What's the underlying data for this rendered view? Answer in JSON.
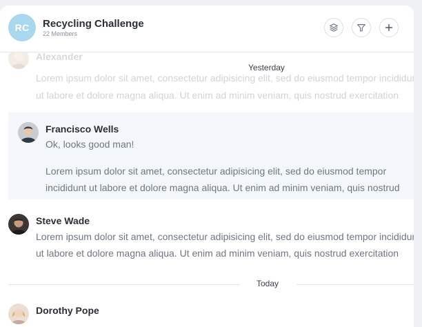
{
  "header": {
    "initials": "RC",
    "title": "Recycling Challenge",
    "members": "22 Members",
    "icons": [
      "layers-icon",
      "filter-icon",
      "plus-icon"
    ]
  },
  "dividers": {
    "yesterday": "Yesterday",
    "today": "Today"
  },
  "messages": [
    {
      "name": "Alexander",
      "lines": [
        "Lorem ipsum dolor sit amet, consectetur adipisicing elit, sed do eiusmod tempor incididunt",
        "ut labore et dolore magna aliqua. Ut enim ad minim veniam, quis nostrud exercitation"
      ]
    },
    {
      "name": "Francisco Wells",
      "short": "Ok, looks good man!",
      "lines": [
        "Lorem ipsum dolor sit amet, consectetur adipisicing elit, sed do eiusmod tempor",
        "incididunt ut labore et dolore magna aliqua. Ut enim ad minim veniam, quis nostrud"
      ]
    },
    {
      "name": "Steve Wade",
      "lines": [
        "Lorem ipsum dolor sit amet, consectetur adipisicing elit, sed do eiusmod tempor incididunt",
        "ut labore et dolore magna aliqua. Ut enim ad minim veniam, quis nostrud exercitation"
      ]
    },
    {
      "name": "Dorothy Pope"
    }
  ]
}
